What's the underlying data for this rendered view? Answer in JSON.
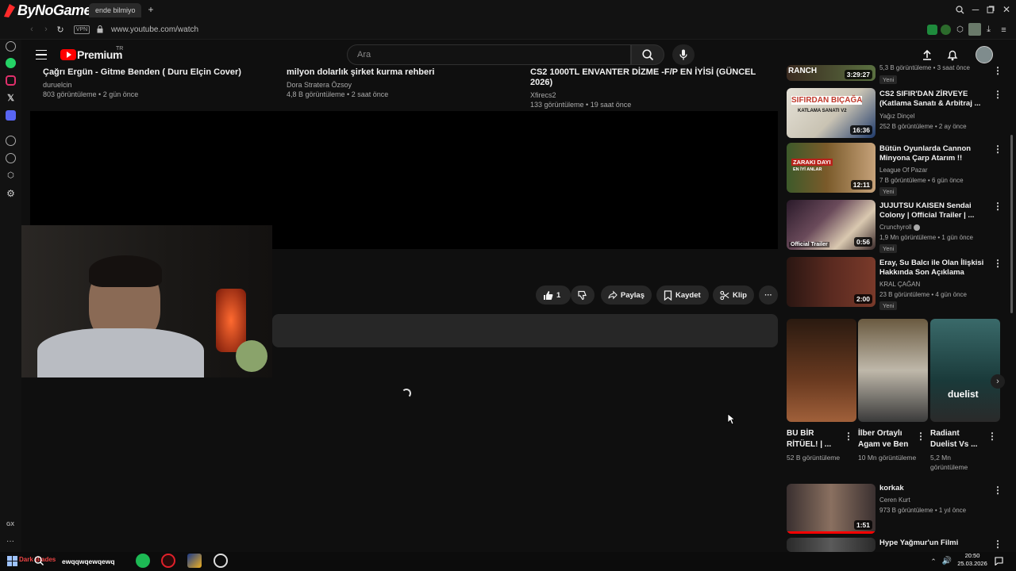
{
  "browser": {
    "logo": "ByNoGame",
    "tab_title": "ende bilmiyo",
    "vpn": "VPN",
    "url": "www.youtube.com/watch"
  },
  "header": {
    "brand": "Premium",
    "region": "TR",
    "search_placeholder": "Ara"
  },
  "top_videos": [
    {
      "title": "Çağrı Ergün - Gitme Benden ( Duru Elçin Cover)",
      "channel": "duruelcin",
      "meta": "803 görüntüleme • 2 gün önce"
    },
    {
      "title": "milyon dolarlık şirket kurma rehberi",
      "channel": "Dora Stratera Özsoy",
      "meta": "4,8 B görüntüleme • 2 saat önce"
    },
    {
      "title": "CS2 1000TL ENVANTER DİZME -F/P EN İYİSİ (GÜNCEL 2026)",
      "channel": "Xfirecs2",
      "meta": "133 görüntüleme • 19 saat önce"
    }
  ],
  "actions": {
    "likes": "1",
    "share": "Paylaş",
    "save": "Kaydet",
    "clip": "Klip"
  },
  "sidebar": {
    "partial_top": {
      "duration": "3:29:27",
      "meta": "5,3 B görüntüleme • 3 saat önce",
      "badge": "Yeni",
      "thumb_text": "RANCH"
    },
    "videos": [
      {
        "title": "CS2 SIFIR'DAN ZİRVEYE (Katlama Sanatı & Arbitraj ...",
        "channel": "Yağız Dinçel",
        "meta": "252 B görüntüleme • 2 ay önce",
        "duration": "16:36",
        "thumb_text": "SIFIRDAN BIÇAĞA",
        "thumb_sub": "KATLAMA SANATI V2",
        "badge": ""
      },
      {
        "title": "Bütün Oyunlarda Cannon Minyona Çarp Atarım !!",
        "channel": "League Of Pazar",
        "meta": "7 B görüntüleme • 6 gün önce",
        "duration": "12:11",
        "thumb_text": "ZARAKI DAYI",
        "thumb_sub": "EN İYİ ANLAR",
        "badge": "Yeni"
      },
      {
        "title": "JUJUTSU KAISEN Sendai Colony | Official Trailer | ...",
        "channel": "Crunchyroll",
        "meta": "1,9 Mn görüntüleme • 1 gün önce",
        "duration": "0:56",
        "thumb_text": "Official Trailer",
        "badge": "Yeni"
      },
      {
        "title": "Eray, Su Balcı ile Olan İlişkisi Hakkında Son Açıklama",
        "channel": "KRAL ÇAĞAN",
        "meta": "23 B görüntüleme • 4 gün önce",
        "duration": "2:00",
        "badge": "Yeni"
      }
    ],
    "shorts": [
      {
        "title": "BU BİR RİTÜEL! | ...",
        "meta": "52 B görüntüleme"
      },
      {
        "title": "İlber Ortaylı Agam ve Ben",
        "meta": "10 Mn görüntüleme"
      },
      {
        "title": "Radiant Duelist Vs ...",
        "meta": "5,2 Mn görüntüleme",
        "thumb_text": "duelist"
      }
    ],
    "after": [
      {
        "title": "korkak",
        "channel": "Ceren Kurt",
        "meta": "973 B görüntüleme • 1 yıl önce",
        "duration": "1:51"
      },
      {
        "title": "Hype Yağmur'un Filmi"
      }
    ]
  },
  "taskbar": {
    "search_text": "ewqqwqewqewq",
    "tray_label": "Dark Blades",
    "time": "20:50",
    "date": "25.03.2026"
  },
  "left_rail": {
    "gx": "GX"
  },
  "colors": {
    "accent": "#ff0000",
    "bg": "#0f0f0f",
    "pill": "#272727"
  }
}
